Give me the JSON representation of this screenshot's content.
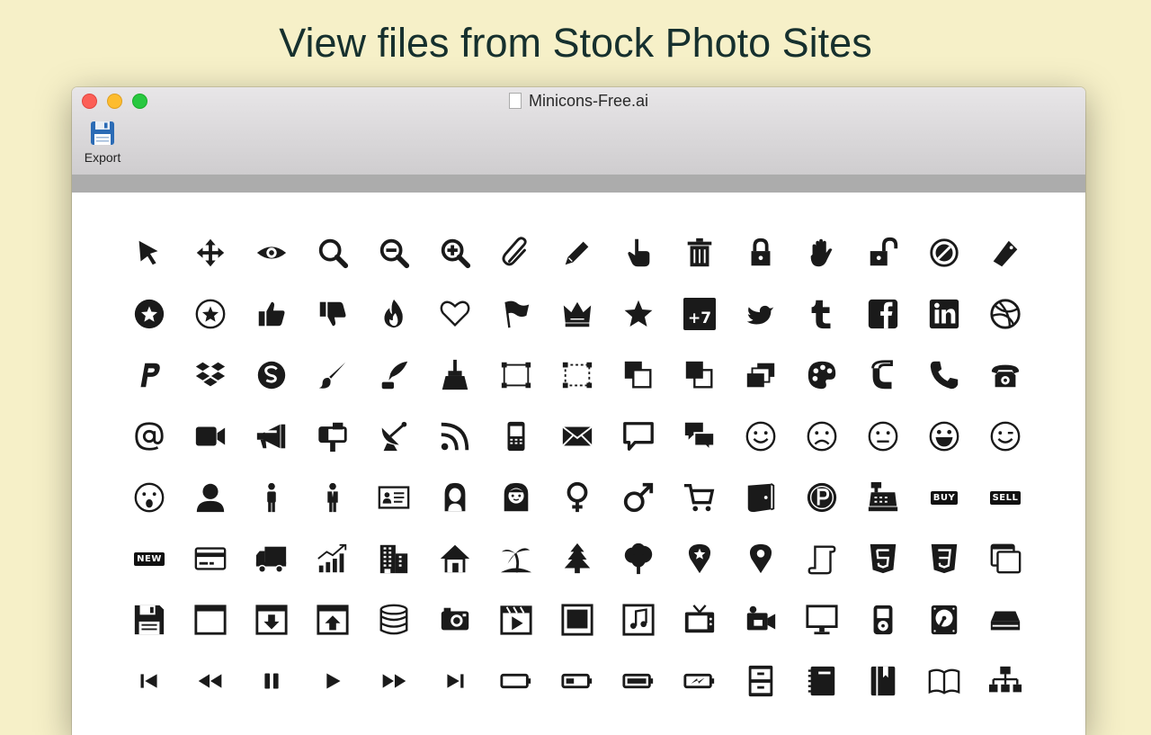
{
  "headline": "View files from Stock Photo Sites",
  "window": {
    "title": "Minicons-Free.ai",
    "toolbar": {
      "export_label": "Export"
    }
  },
  "icons": [
    [
      "cursor-arrow",
      "move-arrows",
      "eye",
      "magnifier",
      "zoom-out",
      "zoom-in",
      "paperclip",
      "pencil",
      "pointing-hand",
      "trash-can",
      "lock",
      "open-hand",
      "unlocked",
      "no-sign",
      "tag"
    ],
    [
      "star-circle-filled",
      "star-circle-outline",
      "thumbs-up",
      "thumbs-down",
      "flame",
      "heart",
      "flag",
      "crown",
      "star",
      "calendar-plus-7",
      "twitter-bird",
      "tumblr",
      "facebook",
      "linkedin",
      "dribbble"
    ],
    [
      "paypal",
      "dropbox",
      "skype",
      "paintbrush",
      "quill-ink",
      "broom",
      "selection-square",
      "selection-dashed",
      "bring-front",
      "send-back",
      "layers",
      "palette",
      "magnet",
      "phone-handset",
      "rotary-phone"
    ],
    [
      "at-sign",
      "video-camera",
      "megaphone",
      "mailbox",
      "satellite-dish",
      "rss",
      "mobile-phone",
      "envelope",
      "speech-bubble",
      "chat-bubbles",
      "smiley-happy",
      "smiley-sad",
      "smiley-neutral",
      "smiley-grin",
      "smiley-wink"
    ],
    [
      "smiley-surprised",
      "user-bust",
      "person-male",
      "person-businessman",
      "id-card",
      "woman",
      "girl",
      "female-symbol",
      "male-symbol",
      "shopping-cart",
      "wallet",
      "parking-coin",
      "cash-register",
      "buy-label",
      "sell-label"
    ],
    [
      "new-label",
      "credit-card",
      "truck",
      "bar-chart-growth",
      "buildings",
      "house",
      "palm-island",
      "pine-tree",
      "tree",
      "map-pin-star",
      "map-pin",
      "scroll",
      "html5",
      "css3",
      "windows-stack"
    ],
    [
      "floppy-disk",
      "browser-window",
      "download-window",
      "upload-window",
      "database",
      "camera",
      "video-clip",
      "picture-frame",
      "music-file",
      "television",
      "camcorder",
      "monitor",
      "ipod",
      "hard-disk",
      "drive-tray"
    ],
    [
      "skip-back",
      "rewind",
      "pause",
      "play",
      "fast-forward",
      "skip-forward",
      "battery-empty",
      "battery-low",
      "battery-full",
      "battery-charging",
      "filing-cabinet",
      "notebook",
      "book-closed",
      "book-open",
      "sitemap"
    ]
  ],
  "icon_labels": {
    "calendar": "+7",
    "buy": "BUY",
    "sell": "SELL",
    "new": "NEW"
  }
}
